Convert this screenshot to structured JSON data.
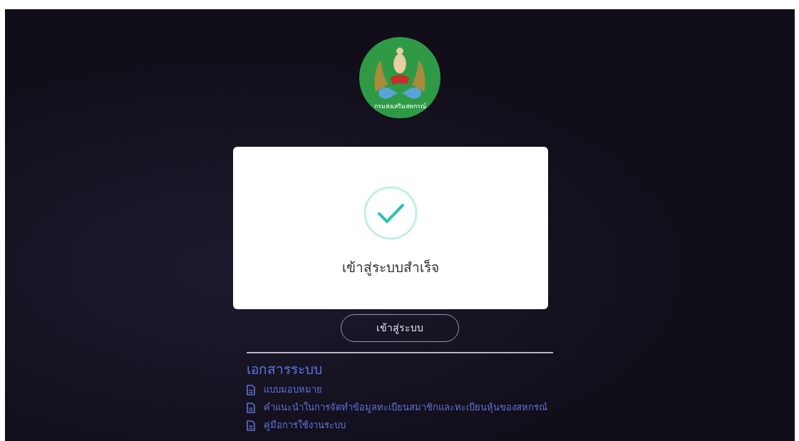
{
  "logo": {
    "ring_text": "กรมส่งเสริมสหกรณ์"
  },
  "login_button": "เข้าสู่ระบบ",
  "documents": {
    "heading": "เอกสารระบบ",
    "items": [
      {
        "label": "แบบมอบหมาย"
      },
      {
        "label": "คำแนะนำในการจัดทำข้อมูลทะเบียนสมาชิกและทะเบียนหุ้นของสหกรณ์"
      },
      {
        "label": "คู่มือการใช้งานระบบ"
      }
    ]
  },
  "dialog": {
    "kind": "success",
    "message": "เข้าสู่ระบบสำเร็จ"
  }
}
